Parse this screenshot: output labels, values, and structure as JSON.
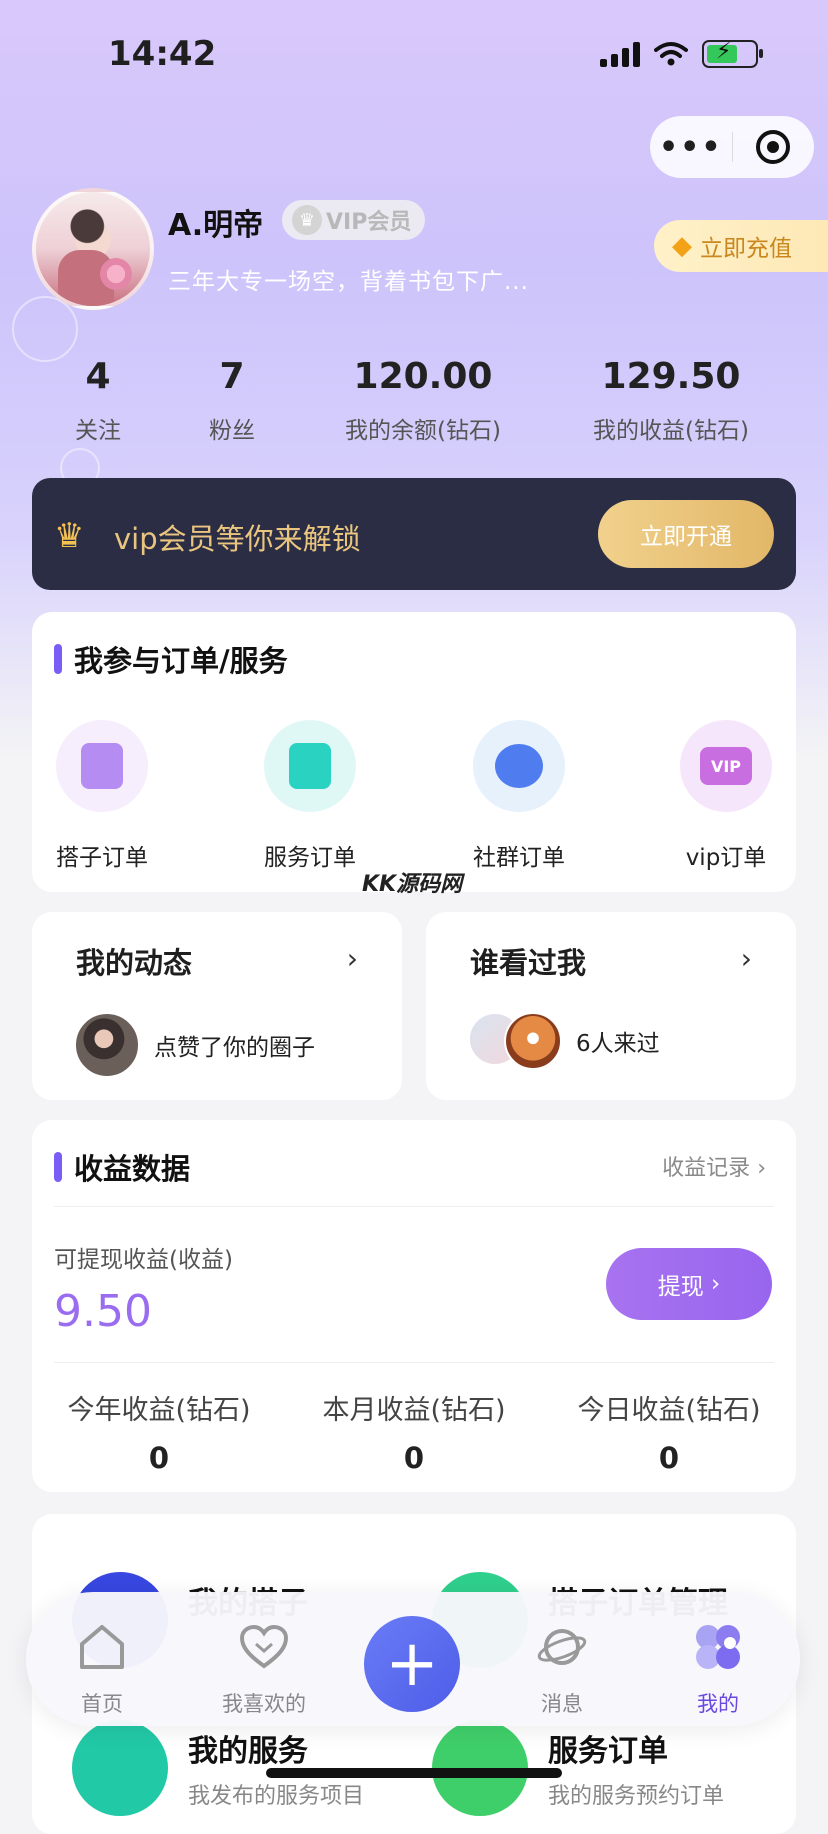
{
  "status": {
    "time": "14:42"
  },
  "profile": {
    "name": "A.明帝",
    "vip_badge": "VIP会员",
    "bio": "三年大专一场空，背着书包下广...",
    "recharge": "立即充值"
  },
  "stats": [
    {
      "value": "4",
      "label": "关注"
    },
    {
      "value": "7",
      "label": "粉丝"
    },
    {
      "value": "120.00",
      "label": "我的余额(钻石)"
    },
    {
      "value": "129.50",
      "label": "我的收益(钻石)"
    }
  ],
  "vip_banner": {
    "text": "vip会员等你来解锁",
    "button": "立即开通"
  },
  "orders": {
    "title": "我参与订单/服务",
    "items": [
      {
        "label": "搭子订单",
        "icon": "partner-order-icon"
      },
      {
        "label": "服务订单",
        "icon": "clipboard-icon"
      },
      {
        "label": "社群订单",
        "icon": "chat-bubble-icon"
      },
      {
        "label": "vip订单",
        "icon": "vip-card-icon"
      }
    ]
  },
  "watermark": "KK源码网",
  "dynamics": {
    "title": "我的动态",
    "text": "点赞了你的圈子"
  },
  "visitors": {
    "title": "谁看过我",
    "text": "6人来过"
  },
  "income": {
    "title": "收益数据",
    "record_link": "收益记录",
    "available_label": "可提现收益(收益)",
    "available_value": "9.50",
    "withdraw": "提现",
    "stats": [
      {
        "label": "今年收益(钻石)",
        "value": "0"
      },
      {
        "label": "本月收益(钻石)",
        "value": "0"
      },
      {
        "label": "今日收益(钻石)",
        "value": "0"
      }
    ]
  },
  "tools": [
    {
      "title": "我的搭子",
      "sub": ""
    },
    {
      "title": "搭子订单管理",
      "sub": ""
    },
    {
      "title": "我的服务",
      "sub": "我发布的服务项目"
    },
    {
      "title": "服务订单",
      "sub": "我的服务预约订单"
    }
  ],
  "tabbar": {
    "items": [
      {
        "label": "首页",
        "icon": "home-icon"
      },
      {
        "label": "我喜欢的",
        "icon": "heart-icon"
      },
      {
        "label": "",
        "icon": "plus-icon"
      },
      {
        "label": "消息",
        "icon": "planet-icon"
      },
      {
        "label": "我的",
        "icon": "profile-blob-icon"
      }
    ],
    "active": "我的"
  },
  "colors": {
    "accent": "#7a5df5",
    "income_value": "#9a6df0",
    "vip_banner_bg": "#2b2d44",
    "gold": "#e9c57f"
  }
}
